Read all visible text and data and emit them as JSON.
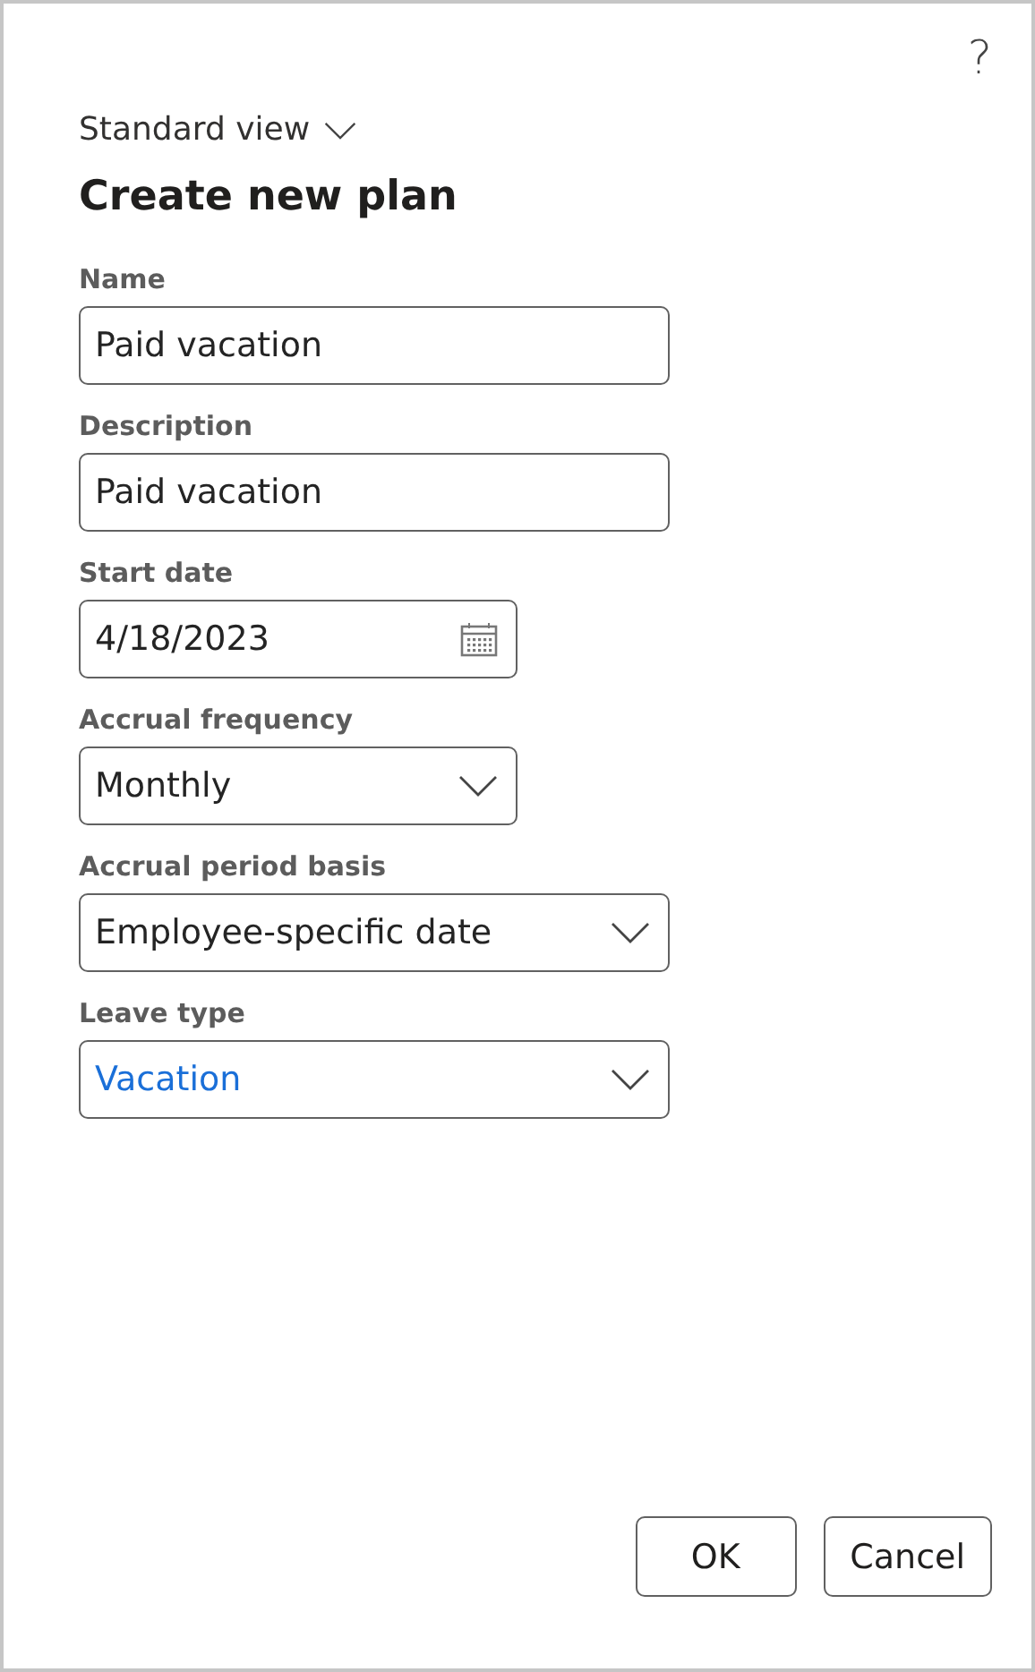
{
  "help": {
    "label": "?"
  },
  "view_selector": {
    "label": "Standard view"
  },
  "title": "Create new plan",
  "fields": [
    {
      "label": "Name",
      "kind": "text",
      "value": "Paid vacation"
    },
    {
      "label": "Description",
      "kind": "text",
      "value": "Paid vacation"
    },
    {
      "label": "Start date",
      "kind": "date",
      "value": "4/18/2023"
    },
    {
      "label": "Accrual frequency",
      "kind": "select",
      "value": "Monthly"
    },
    {
      "label": "Accrual period basis",
      "kind": "select",
      "value": "Employee-specific date"
    },
    {
      "label": "Leave type",
      "kind": "select",
      "value": "Vacation",
      "linked": true
    }
  ],
  "buttons": [
    "OK",
    "Cancel"
  ]
}
